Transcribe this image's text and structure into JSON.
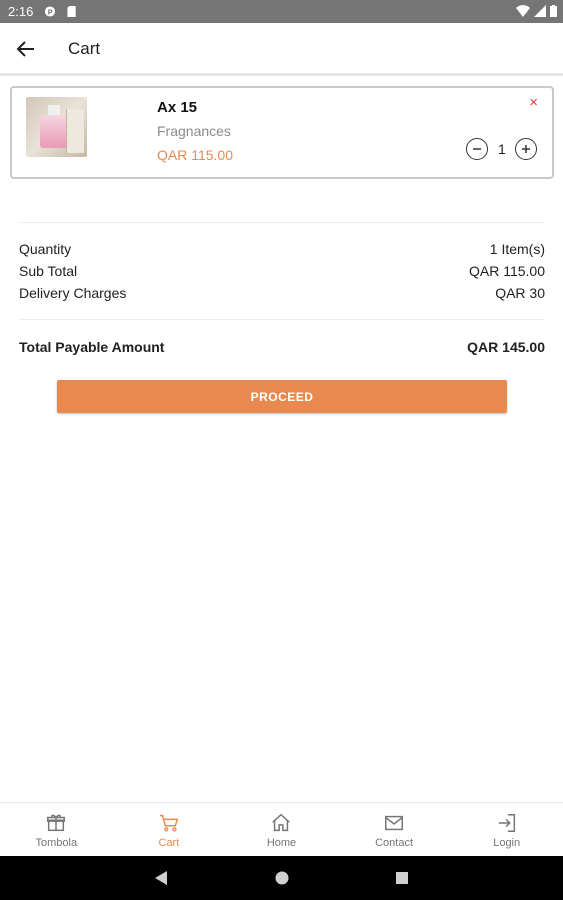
{
  "status_bar": {
    "time": "2:16"
  },
  "header": {
    "title": "Cart"
  },
  "cart_item": {
    "name": "Ax 15",
    "category": "Fragnances",
    "price": "QAR 115.00",
    "quantity": "1",
    "remove_label": "×"
  },
  "summary": {
    "quantity_label": "Quantity",
    "quantity_value": "1 Item(s)",
    "subtotal_label": "Sub Total",
    "subtotal_value": "QAR 115.00",
    "delivery_label": "Delivery Charges",
    "delivery_value": "QAR 30",
    "total_label": "Total Payable Amount",
    "total_value": "QAR 145.00"
  },
  "proceed_label": "PROCEED",
  "bottom_nav": [
    {
      "label": "Tombola",
      "icon": "gift-icon",
      "active": false
    },
    {
      "label": "Cart",
      "icon": "cart-icon",
      "active": true
    },
    {
      "label": "Home",
      "icon": "home-icon",
      "active": false
    },
    {
      "label": "Contact",
      "icon": "mail-icon",
      "active": false
    },
    {
      "label": "Login",
      "icon": "login-icon",
      "active": false
    }
  ],
  "colors": {
    "accent": "#e8894f",
    "remove": "#e53935",
    "status_bar": "#757575"
  }
}
